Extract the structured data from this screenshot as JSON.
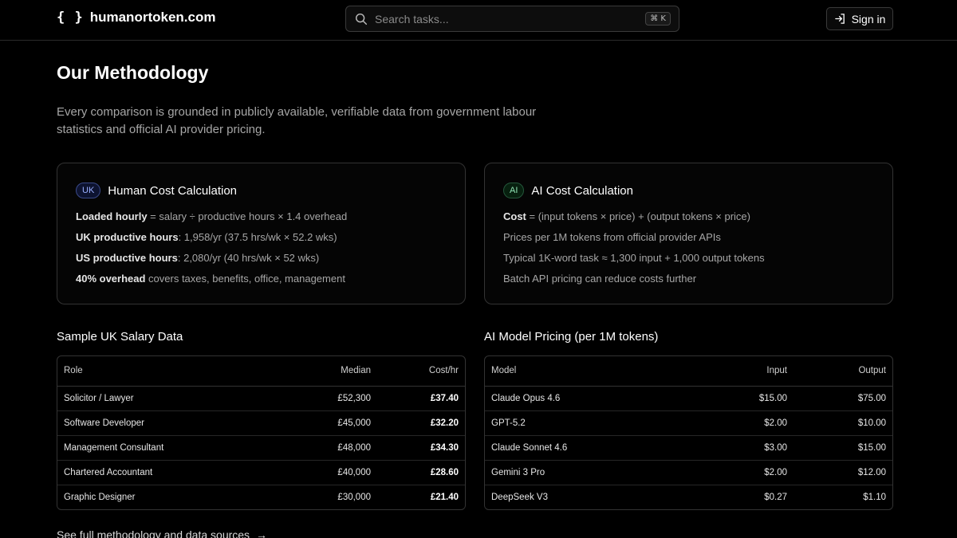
{
  "header": {
    "brand_icon": "{ }",
    "brand_text": "humanortoken.com",
    "search_placeholder": "Search tasks...",
    "shortcut": "⌘ K",
    "signin_label": "Sign in"
  },
  "page": {
    "title": "Our Methodology",
    "intro": "Every comparison is grounded in publicly available, verifiable data from government labour statistics and official AI provider pricing."
  },
  "human_card": {
    "badge": "UK",
    "title": "Human Cost Calculation",
    "lines": [
      {
        "bold": "Loaded hourly",
        "rest": " = salary ÷ productive hours × 1.4 overhead"
      },
      {
        "bold": "UK productive hours",
        "rest": ": 1,958/yr (37.5 hrs/wk × 52.2 wks)"
      },
      {
        "bold": "US productive hours",
        "rest": ": 2,080/yr (40 hrs/wk × 52 wks)"
      },
      {
        "bold": "40% overhead",
        "rest": " covers taxes, benefits, office, management"
      }
    ]
  },
  "ai_card": {
    "badge": "AI",
    "title": "AI Cost Calculation",
    "lines": [
      {
        "bold": "Cost",
        "rest": " = (input tokens × price) + (output tokens × price)"
      },
      {
        "bold": "",
        "rest": "Prices per 1M tokens from official provider APIs"
      },
      {
        "bold": "",
        "rest": "Typical 1K-word task ≈ 1,300 input + 1,000 output tokens"
      },
      {
        "bold": "",
        "rest": "Batch API pricing can reduce costs further"
      }
    ]
  },
  "salary_table": {
    "title": "Sample UK Salary Data",
    "headers": [
      "Role",
      "Median",
      "Cost/hr"
    ],
    "rows": [
      [
        "Solicitor / Lawyer",
        "£52,300",
        "£37.40"
      ],
      [
        "Software Developer",
        "£45,000",
        "£32.20"
      ],
      [
        "Management Consultant",
        "£48,000",
        "£34.30"
      ],
      [
        "Chartered Accountant",
        "£40,000",
        "£28.60"
      ],
      [
        "Graphic Designer",
        "£30,000",
        "£21.40"
      ]
    ]
  },
  "pricing_table": {
    "title": "AI Model Pricing (per 1M tokens)",
    "headers": [
      "Model",
      "Input",
      "Output"
    ],
    "rows": [
      [
        "Claude Opus 4.6",
        "$15.00",
        "$75.00"
      ],
      [
        "GPT-5.2",
        "$2.00",
        "$10.00"
      ],
      [
        "Claude Sonnet 4.6",
        "$3.00",
        "$15.00"
      ],
      [
        "Gemini 3 Pro",
        "$2.00",
        "$12.00"
      ],
      [
        "DeepSeek V3",
        "$0.27",
        "$1.10"
      ]
    ]
  },
  "footer": {
    "link": "See full methodology and data sources",
    "arrow": "→"
  }
}
